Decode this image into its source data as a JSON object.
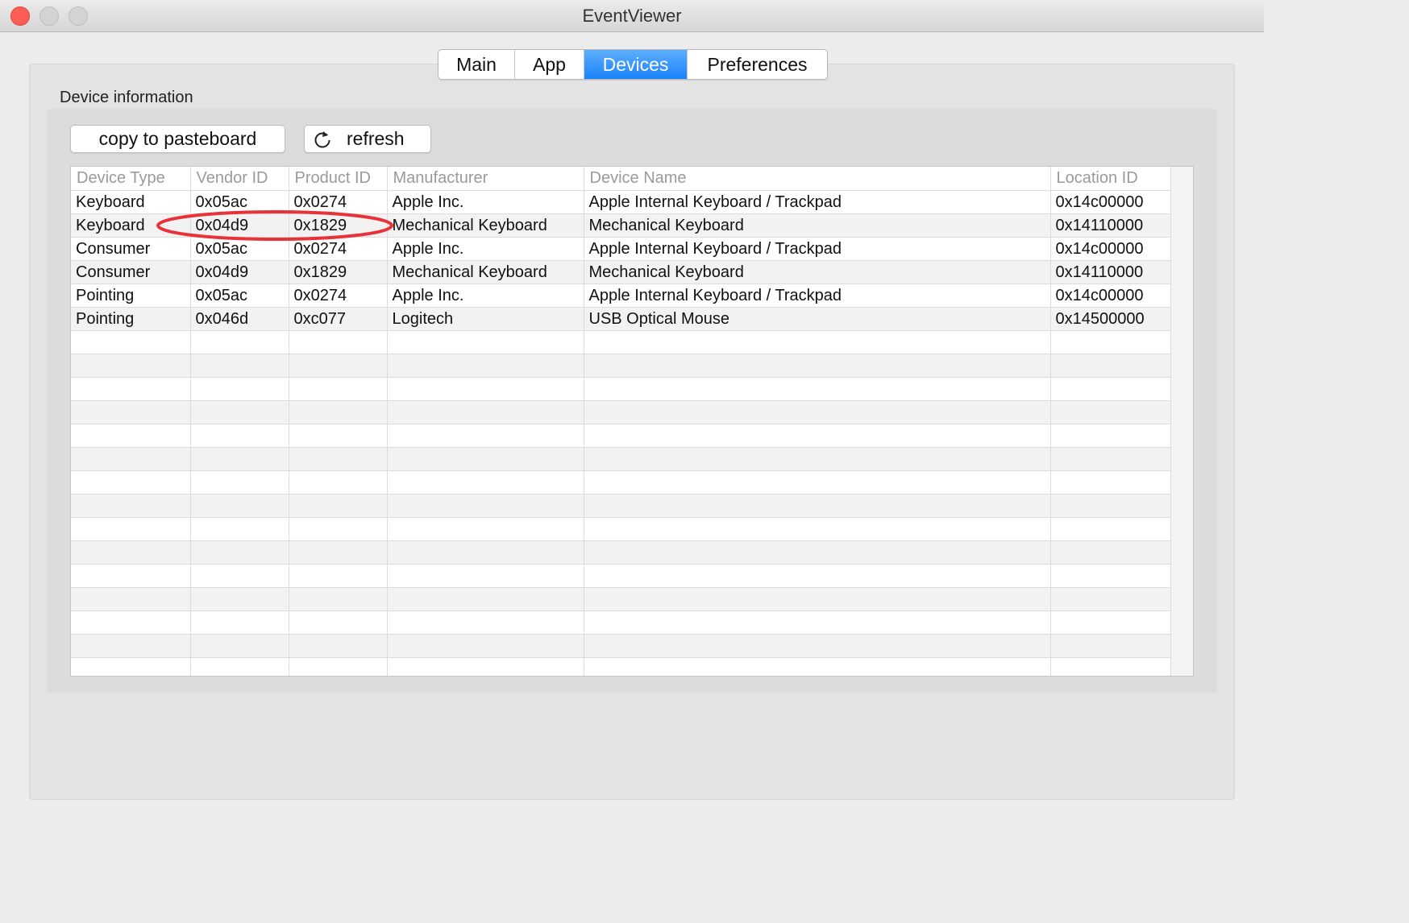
{
  "window": {
    "title": "EventViewer"
  },
  "tabs": [
    {
      "label": "Main",
      "active": false
    },
    {
      "label": "App",
      "active": false
    },
    {
      "label": "Devices",
      "active": true
    },
    {
      "label": "Preferences",
      "active": false
    }
  ],
  "device_info": {
    "label": "Device information",
    "copy_button": "copy to pasteboard",
    "refresh_button": "refresh",
    "columns": [
      "Device Type",
      "Vendor ID",
      "Product ID",
      "Manufacturer",
      "Device Name",
      "Location ID"
    ],
    "rows": [
      [
        "Keyboard",
        "0x05ac",
        "0x0274",
        "Apple Inc.",
        "Apple Internal Keyboard / Trackpad",
        "0x14c00000"
      ],
      [
        "Keyboard",
        "0x04d9",
        "0x1829",
        "Mechanical Keyboard",
        "Mechanical Keyboard",
        "0x14110000"
      ],
      [
        "Consumer",
        "0x05ac",
        "0x0274",
        "Apple Inc.",
        "Apple Internal Keyboard / Trackpad",
        "0x14c00000"
      ],
      [
        "Consumer",
        "0x04d9",
        "0x1829",
        "Mechanical Keyboard",
        "Mechanical Keyboard",
        "0x14110000"
      ],
      [
        "Pointing",
        "0x05ac",
        "0x0274",
        "Apple Inc.",
        "Apple Internal Keyboard / Trackpad",
        "0x14c00000"
      ],
      [
        "Pointing",
        "0x046d",
        "0xc077",
        "Logitech",
        "USB Optical Mouse",
        "0x14500000"
      ]
    ],
    "empty_rows": 15
  },
  "colors": {
    "accent": "#1a82fb",
    "annotation": "#e8323a",
    "close_button": "#fc5d57"
  },
  "icons": [
    "close-icon",
    "minimize-icon",
    "zoom-icon",
    "refresh-icon"
  ]
}
